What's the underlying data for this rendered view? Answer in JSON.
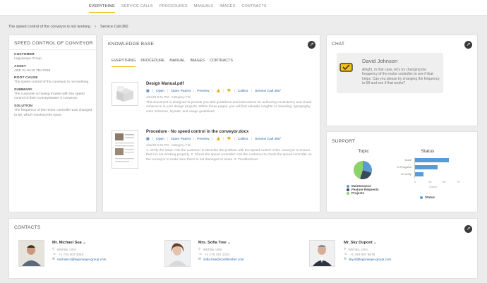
{
  "nav": {
    "tabs": [
      "EVERYTHING",
      "SERVICE CALLS",
      "PROCEDURES",
      "MANUALS",
      "IMAGES",
      "CONTRACTS"
    ],
    "active": 0
  },
  "breadcrumb": {
    "item1": "The speed control of the conveyor is not working",
    "item2": "Service Call-360"
  },
  "summary": {
    "title": "SPEED CONTROL OF CONVEYOR",
    "fields": [
      {
        "label": "CUSTOMER",
        "value": "Legorwaye Group"
      },
      {
        "label": "ASSET",
        "value": "ABE 31-0A10 TBA7598"
      },
      {
        "label": "ROOT CAUSE",
        "value": "The speed control of the conveyor is not working."
      },
      {
        "label": "SUMMARY",
        "value": "The customer is having trouble with the speed control of their ConveyMaster II conveyor."
      },
      {
        "label": "SOLUTION",
        "value": "The frequency of the motor controller was changed to 58, which resolved the issue."
      }
    ]
  },
  "kb": {
    "title": "KNOWLEDGE BASE",
    "tabs": [
      "EVERYTHING",
      "PROCEDURE",
      "MANUAL",
      "IMAGES",
      "CONTRACTS"
    ],
    "actions": {
      "open": "Open",
      "open_parent": "Open Parent",
      "preview": "Preview",
      "collect": "Collect",
      "service_call": "Service Call 360°"
    },
    "results": [
      {
        "title": "Design Manual.pdf",
        "meta": "4/11/22 9:41 PM  ·  Category: File",
        "snippet": "This document is designed to provide you with guidelines and instructions for achieving consistency and visual coherence in your design projects. Within these pages, you will find valuable insights on branding, typography, color schemes, layouts, and usage guidelines"
      },
      {
        "title": "Procedure - No speed control in the conveyor.docx",
        "meta": "4/11/22 9:44 PM  ·  Category: File",
        "snippet": "1. Verify the issue: Ask the customer to describe the problem with the speed control of the conveyor to ensure that it is not working properly. 2. Check the speed controller: Ask the customer to check the speed controller on the conveyor to make sure that it is not damaged or loose. 3. Troubleshoot..."
      }
    ]
  },
  "chat": {
    "title": "CHAT",
    "agent": "David Johnson",
    "message": "Alright, in that case, let's try changing the frequency of the motor controller to see if that helps. Can you please try changing the frequency to 58 and see if that works?"
  },
  "support": {
    "title": "SUPPORT",
    "topic_title": "Topic",
    "status_title": "Status",
    "topic_slices": [
      {
        "name": "Maintenance",
        "value": 30,
        "color": "#5b9bd5"
      },
      {
        "name": "Feature Requests",
        "value": 25,
        "color": "#3a4a5a"
      },
      {
        "name": "Projects",
        "value": 45,
        "color": "#8dd36a"
      }
    ],
    "status_bars": [
      {
        "name": "Done",
        "value": 60
      },
      {
        "name": "In Progress",
        "value": 40
      },
      {
        "name": "To Verify",
        "value": 15
      }
    ],
    "status_ticks": [
      "0",
      "25",
      "50",
      "75"
    ],
    "status_axis_label": "Count",
    "status_legend": "Status",
    "bar_color": "#5b9bd5"
  },
  "contacts": {
    "title": "CONTACTS",
    "people": [
      {
        "name": "Mr. Michael Sea",
        "location": "Wichita, USA",
        "phone": "+1 734 402 3340",
        "email": "michael.s@legorwaye-group.com"
      },
      {
        "name": "Mrs. Sofia Tree",
        "location": "Wichita, USA",
        "phone": "+1 170 321 1234",
        "email": "sofia.tree@coolfinisher.com"
      },
      {
        "name": "Mr. Sky Dupont",
        "location": "Wichita, USA",
        "phone": "+1 345 067 9678",
        "email": "sky.d@legorwaye-group.com"
      }
    ]
  }
}
